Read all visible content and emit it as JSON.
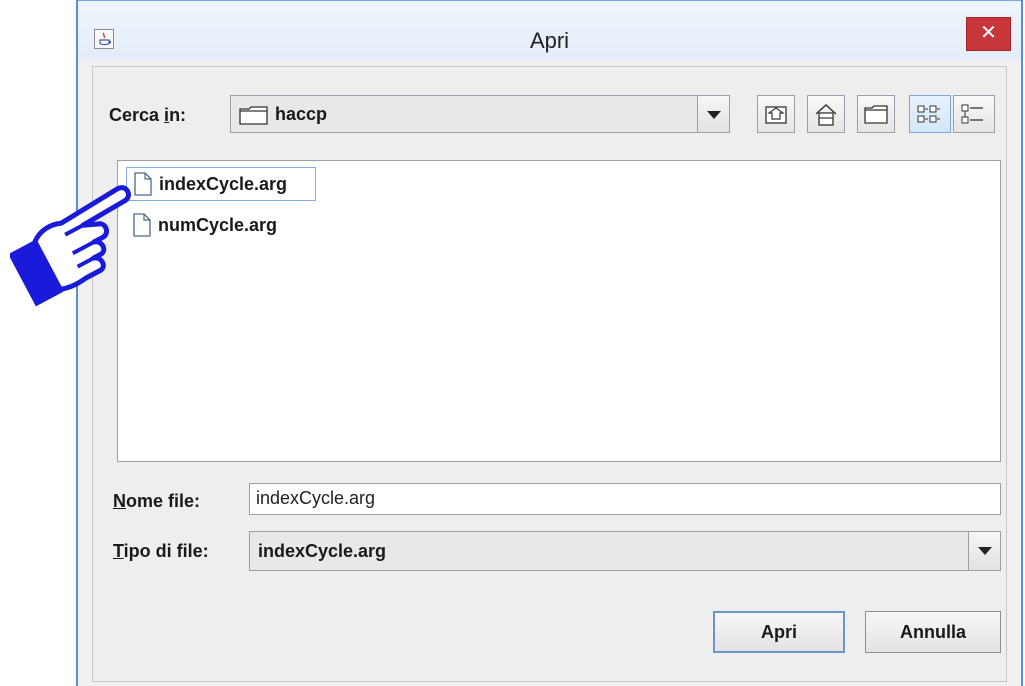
{
  "window": {
    "title": "Apri",
    "close_label": "✕"
  },
  "lookin": {
    "label_prefix": "Cerca ",
    "label_mnemonic": "i",
    "label_suffix": "n:",
    "folder_name": "haccp"
  },
  "toolbar": {
    "buttons": [
      "up-folder",
      "home",
      "new-folder",
      "list-view",
      "details-view"
    ]
  },
  "files": [
    {
      "name": "indexCycle.arg",
      "selected": true
    },
    {
      "name": "numCycle.arg",
      "selected": false
    }
  ],
  "filename": {
    "label_mnemonic": "N",
    "label_rest": "ome file:",
    "value": "indexCycle.arg"
  },
  "filetype": {
    "label_mnemonic": "T",
    "label_rest": "ipo di file:",
    "value": "indexCycle.arg"
  },
  "buttons": {
    "open": "Apri",
    "cancel": "Annulla"
  },
  "colors": {
    "close_red": "#c7373a",
    "hand_blue": "#1a1adb",
    "accent": "#5a8fd6"
  }
}
